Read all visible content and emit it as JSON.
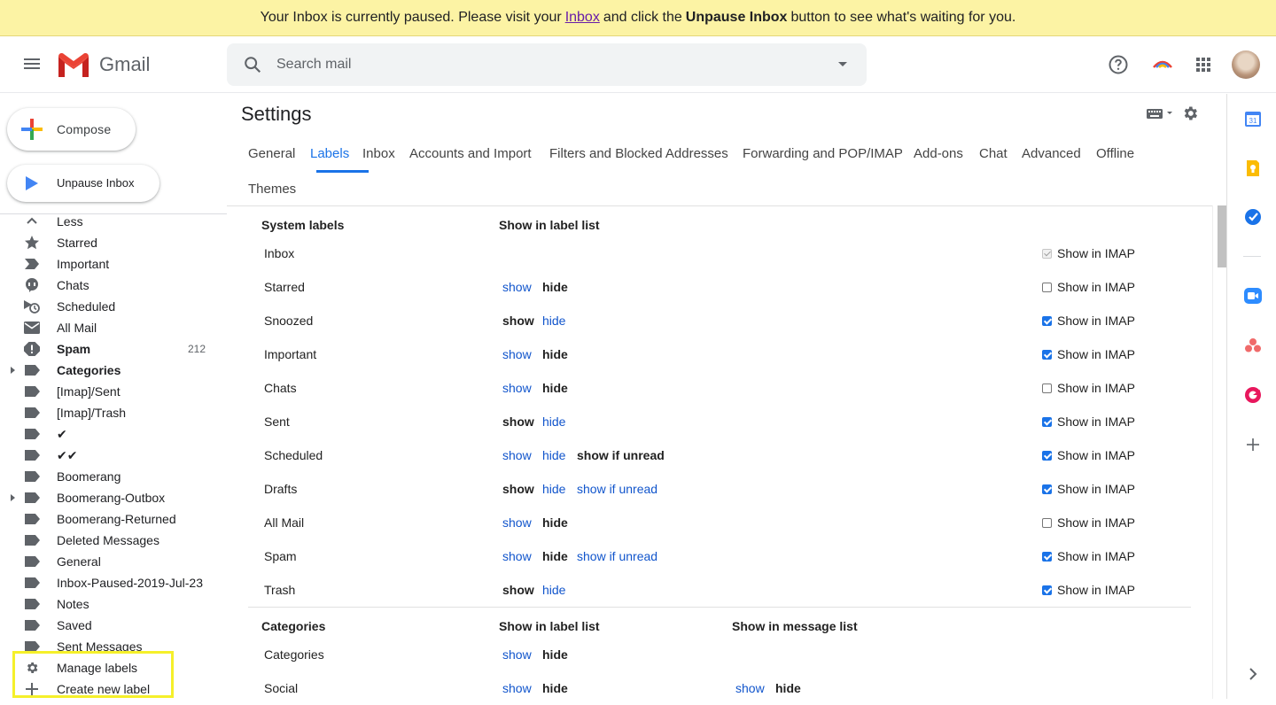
{
  "banner": {
    "text_before": "Your Inbox is currently paused. Please visit your",
    "link": "Inbox",
    "text_middle": "and click the",
    "bold": "Unpause Inbox",
    "text_after": "button to see what's waiting for you."
  },
  "header": {
    "app_name": "Gmail",
    "search_placeholder": "Search mail"
  },
  "sidebar": {
    "compose": "Compose",
    "unpause": "Unpause Inbox",
    "items": [
      {
        "label": "Less",
        "icon": "chevron-up-icon"
      },
      {
        "label": "Starred",
        "icon": "star-icon"
      },
      {
        "label": "Important",
        "icon": "important-icon"
      },
      {
        "label": "Chats",
        "icon": "chat-icon"
      },
      {
        "label": "Scheduled",
        "icon": "scheduled-icon"
      },
      {
        "label": "All Mail",
        "icon": "mail-icon"
      },
      {
        "label": "Spam",
        "icon": "spam-icon",
        "count": "212",
        "bold": true
      },
      {
        "label": "Categories",
        "icon": "label-icon",
        "bold": true,
        "expandable": true
      },
      {
        "label": "[Imap]/Sent",
        "icon": "label-icon"
      },
      {
        "label": "[Imap]/Trash",
        "icon": "label-icon"
      },
      {
        "label": "✔",
        "icon": "label-icon"
      },
      {
        "label": "✔✔",
        "icon": "label-icon"
      },
      {
        "label": "Boomerang",
        "icon": "label-icon"
      },
      {
        "label": "Boomerang-Outbox",
        "icon": "label-icon",
        "expandable": true
      },
      {
        "label": "Boomerang-Returned",
        "icon": "label-icon"
      },
      {
        "label": "Deleted Messages",
        "icon": "label-icon"
      },
      {
        "label": "General",
        "icon": "label-icon"
      },
      {
        "label": "Inbox-Paused-2019-Jul-23",
        "icon": "label-icon"
      },
      {
        "label": "Notes",
        "icon": "label-icon"
      },
      {
        "label": "Saved",
        "icon": "label-icon"
      },
      {
        "label": "Sent Messages",
        "icon": "label-icon"
      },
      {
        "label": "Manage labels",
        "icon": "gear-icon"
      },
      {
        "label": "Create new label",
        "icon": "plus-icon"
      }
    ]
  },
  "settings": {
    "title": "Settings",
    "tabs": [
      "General",
      "Labels",
      "Inbox",
      "Accounts and Import",
      "Filters and Blocked Addresses",
      "Forwarding and POP/IMAP",
      "Add-ons",
      "Chat",
      "Advanced",
      "Offline",
      "Themes"
    ],
    "active_tab": "Labels",
    "system_labels": {
      "col1": "System labels",
      "col2": "Show in label list",
      "imap_label": "Show in IMAP",
      "rows": [
        {
          "name": "Inbox",
          "options": [],
          "imap": "disabled"
        },
        {
          "name": "Starred",
          "options": [
            [
              "show",
              "link"
            ],
            [
              "hide",
              "current"
            ]
          ],
          "imap": "off"
        },
        {
          "name": "Snoozed",
          "options": [
            [
              "show",
              "current"
            ],
            [
              "hide",
              "link"
            ]
          ],
          "imap": "on"
        },
        {
          "name": "Important",
          "options": [
            [
              "show",
              "link"
            ],
            [
              "hide",
              "current"
            ]
          ],
          "imap": "on"
        },
        {
          "name": "Chats",
          "options": [
            [
              "show",
              "link"
            ],
            [
              "hide",
              "current"
            ]
          ],
          "imap": "off"
        },
        {
          "name": "Sent",
          "options": [
            [
              "show",
              "current"
            ],
            [
              "hide",
              "link"
            ]
          ],
          "imap": "on"
        },
        {
          "name": "Scheduled",
          "options": [
            [
              "show",
              "link"
            ],
            [
              "hide",
              "link"
            ],
            [
              "show if unread",
              "current"
            ]
          ],
          "imap": "on"
        },
        {
          "name": "Drafts",
          "options": [
            [
              "show",
              "current"
            ],
            [
              "hide",
              "link"
            ],
            [
              "show if unread",
              "link"
            ]
          ],
          "imap": "on"
        },
        {
          "name": "All Mail",
          "options": [
            [
              "show",
              "link"
            ],
            [
              "hide",
              "current"
            ]
          ],
          "imap": "off"
        },
        {
          "name": "Spam",
          "options": [
            [
              "show",
              "link"
            ],
            [
              "hide",
              "current"
            ],
            [
              "show if unread",
              "link"
            ]
          ],
          "imap": "on"
        },
        {
          "name": "Trash",
          "options": [
            [
              "show",
              "current"
            ],
            [
              "hide",
              "link"
            ]
          ],
          "imap": "on"
        }
      ]
    },
    "categories": {
      "col1": "Categories",
      "col2": "Show in label list",
      "col3": "Show in message list",
      "rows": [
        {
          "name": "Categories",
          "label_list": [
            [
              "show",
              "link"
            ],
            [
              "hide",
              "current"
            ]
          ],
          "message_list": []
        },
        {
          "name": "Social",
          "label_list": [
            [
              "show",
              "link"
            ],
            [
              "hide",
              "current"
            ]
          ],
          "message_list": [
            [
              "show",
              "link"
            ],
            [
              "hide",
              "current"
            ]
          ]
        }
      ]
    }
  },
  "colors": {
    "accent": "#1a73e8",
    "link": "#1155cc",
    "banner_bg": "#fcf3a4",
    "highlight": "#f5f02a"
  }
}
